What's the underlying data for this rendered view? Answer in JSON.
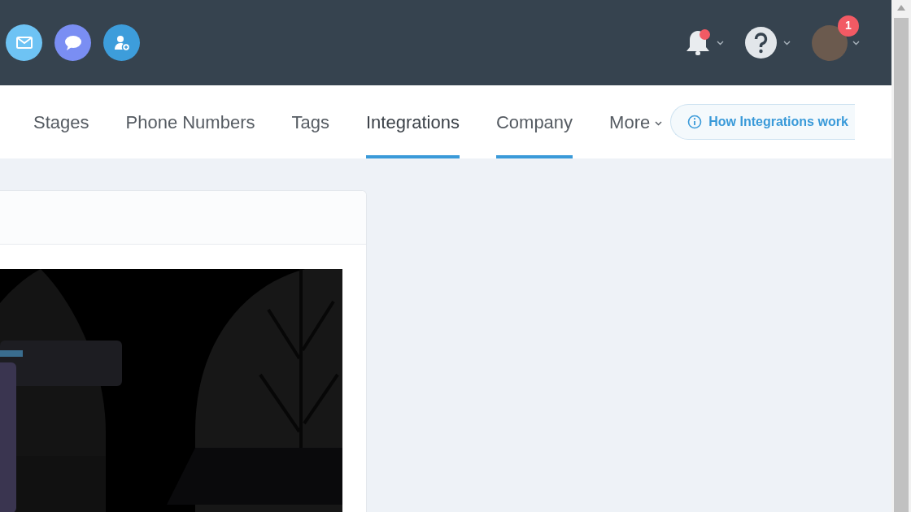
{
  "top_bar": {
    "notifications": {
      "unread": true
    },
    "account": {
      "badge": "1"
    }
  },
  "tabs": [
    {
      "label": "Stages",
      "selected": false,
      "hovered": false
    },
    {
      "label": "Phone Numbers",
      "selected": false,
      "hovered": false
    },
    {
      "label": "Tags",
      "selected": false,
      "hovered": false
    },
    {
      "label": "Integrations",
      "selected": true,
      "hovered": false
    },
    {
      "label": "Company",
      "selected": false,
      "hovered": true
    },
    {
      "label": "More",
      "selected": false,
      "hovered": false,
      "kind": "dropdown"
    }
  ],
  "help_button": {
    "label": "How Integrations work"
  }
}
